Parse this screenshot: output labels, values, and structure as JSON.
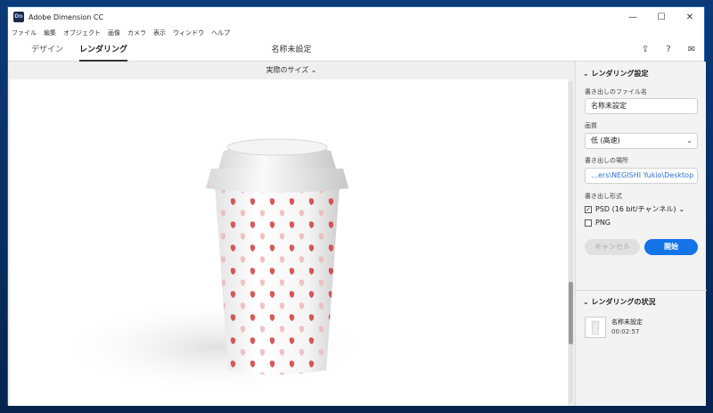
{
  "window": {
    "title": "Adobe Dimension CC",
    "app_icon_text": "Dn",
    "controls": {
      "minimize": "—",
      "maximize": "☐",
      "close": "✕"
    }
  },
  "menu": [
    "ファイル",
    "編集",
    "オブジェクト",
    "画像",
    "カメラ",
    "表示",
    "ウィンドウ",
    "ヘルプ"
  ],
  "tabs": {
    "design": "デザイン",
    "render": "レンダリング"
  },
  "document_title": "名称未設定",
  "top_icons": {
    "share": "⇪",
    "help": "?",
    "comment": "✉"
  },
  "canvas": {
    "view_mode": "実際のサイズ ⌄"
  },
  "render_settings": {
    "section_title": "レンダリング設定",
    "filename_label": "書き出しのファイル名",
    "filename_value": "名称未設定",
    "quality_label": "画質",
    "quality_value": "低 (高速)",
    "location_label": "書き出しの場所",
    "location_value": "…ers\\NEGISHI Yukio\\Desktop",
    "format_label": "書き出し形式",
    "formats": [
      {
        "label": "PSD (16 bit/チャンネル)",
        "checked": true
      },
      {
        "label": "PNG",
        "checked": false
      }
    ],
    "cancel_label": "キャンセル",
    "start_label": "開始"
  },
  "render_status": {
    "section_title": "レンダリングの状況",
    "job_name": "名称未設定",
    "job_time": "00:02:57"
  },
  "colors": {
    "accent": "#1473e6",
    "path_text": "#2d6fd2",
    "strawberry": "#d23c3c"
  }
}
